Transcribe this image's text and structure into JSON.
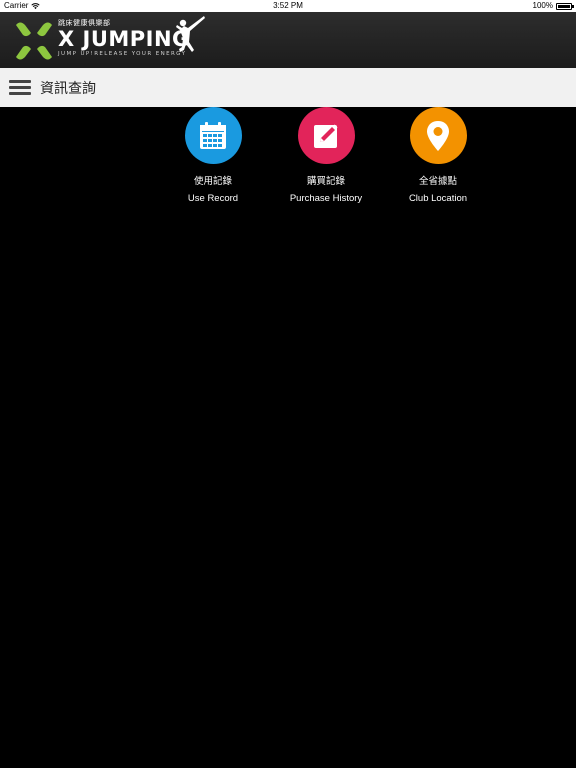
{
  "status_bar": {
    "carrier": "Carrier",
    "time": "3:52 PM",
    "battery": "100%",
    "icons": [
      "wifi-icon",
      "battery-icon"
    ]
  },
  "brand": {
    "subtitle": "跳床健康俱樂部",
    "name": "X JUMPING",
    "tagline": "JUMP UP!RELEASE YOUR ENERGY",
    "icons": [
      "x-logo-icon",
      "jumper-figure-icon"
    ],
    "colors": {
      "x_green": "#8dc63f"
    }
  },
  "nav": {
    "menu_icon": "hamburger-menu-icon",
    "title": "資訊查詢"
  },
  "tiles": [
    {
      "title_zh": "使用記錄",
      "title_en": "Use Record",
      "icon": "calendar-icon",
      "color": "#1a9ae0"
    },
    {
      "title_zh": "購買記錄",
      "title_en": "Purchase History",
      "icon": "edit-note-icon",
      "color": "#e2245a"
    },
    {
      "title_zh": "全省據點",
      "title_en": "Club Location",
      "icon": "location-pin-icon",
      "color": "#f39200"
    }
  ]
}
